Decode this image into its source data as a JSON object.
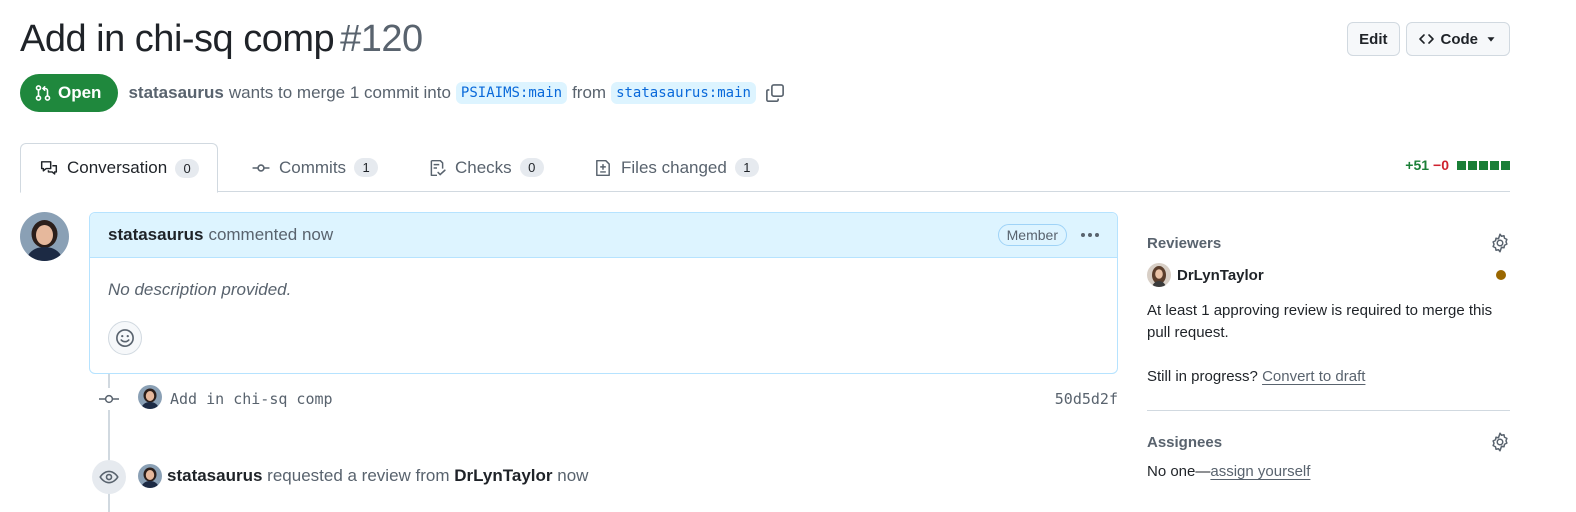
{
  "pr": {
    "title": "Add in chi-sq comp",
    "number": "#120",
    "state": "Open",
    "author": "statasaurus",
    "merge_text": "wants to merge 1 commit into",
    "base_branch": "PSIAIMS:main",
    "from_text": "from",
    "head_branch": "statasaurus:main"
  },
  "header_actions": {
    "edit_label": "Edit",
    "code_label": "Code"
  },
  "tabs": [
    {
      "label": "Conversation",
      "count": "0",
      "icon": "comment-discussion-icon"
    },
    {
      "label": "Commits",
      "count": "1",
      "icon": "git-commit-icon"
    },
    {
      "label": "Checks",
      "count": "0",
      "icon": "checklist-icon"
    },
    {
      "label": "Files changed",
      "count": "1",
      "icon": "file-diff-icon"
    }
  ],
  "diffstat": {
    "additions": "+51",
    "deletions": "−0",
    "blocks": 5
  },
  "comment": {
    "author": "statasaurus",
    "action": "commented now",
    "badge": "Member",
    "body": "No description provided."
  },
  "commit": {
    "message": "Add in chi-sq comp",
    "sha": "50d5d2f"
  },
  "review_event": {
    "actor": "statasaurus",
    "text": "requested a review from",
    "reviewer": "DrLynTaylor",
    "time": "now"
  },
  "sidebar": {
    "reviewers": {
      "heading": "Reviewers",
      "name": "DrLynTaylor",
      "status_color": "#9a6700",
      "note": "At least 1 approving review is required to merge this pull request.",
      "progress_text": "Still in progress?",
      "convert_link": "Convert to draft"
    },
    "assignees": {
      "heading": "Assignees",
      "none_text": "No one—",
      "assign_link": "assign yourself"
    }
  },
  "colors": {
    "open_green": "#1f883d",
    "link_blue": "#0969da",
    "comment_header_bg": "#ddf4ff"
  }
}
